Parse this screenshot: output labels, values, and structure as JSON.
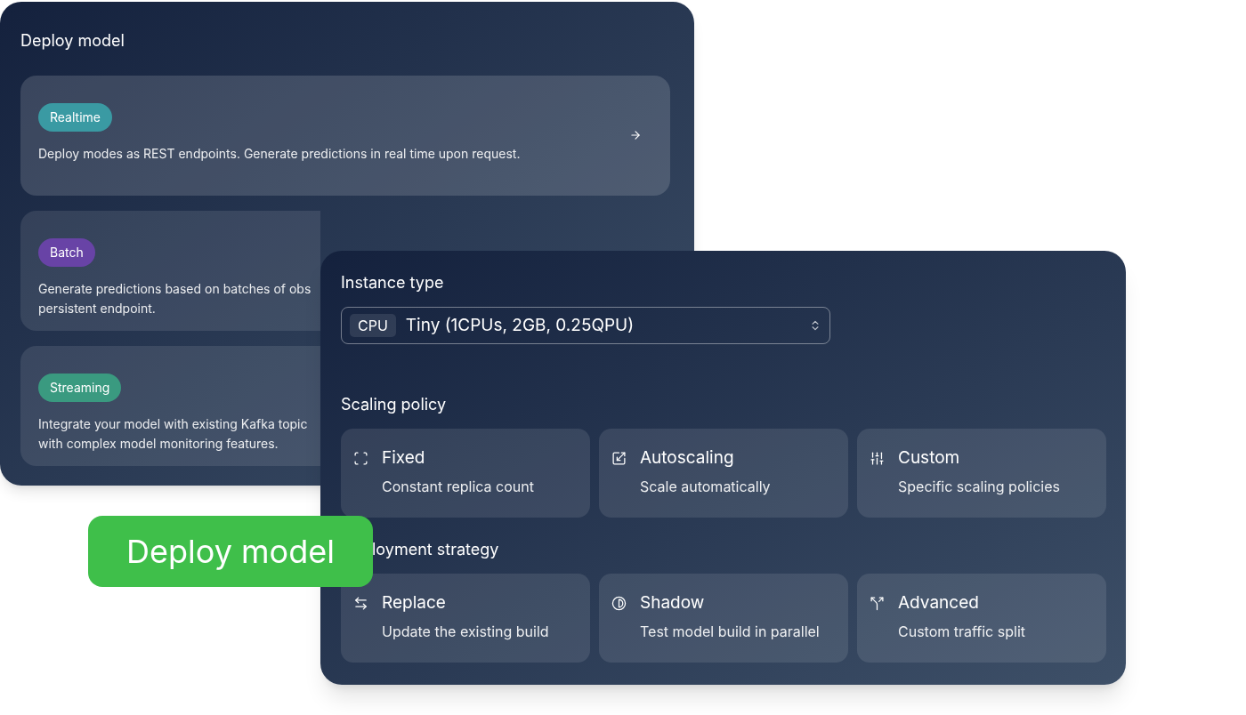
{
  "deploy_panel": {
    "title": "Deploy model",
    "options": [
      {
        "badge": "Realtime",
        "color": "#3a9aa3",
        "lines": [
          "Deploy modes as REST endpoints. Generate predictions in real time upon request."
        ],
        "selected": true
      },
      {
        "badge": "Batch",
        "color": "#6843a6",
        "lines": [
          "Generate predictions based on batches of obs",
          "persistent endpoint."
        ],
        "selected": false
      },
      {
        "badge": "Streaming",
        "color": "#3a9a80",
        "lines": [
          "Integrate your model with existing Kafka topic",
          "with complex model monitoring features."
        ],
        "selected": false
      }
    ]
  },
  "config_panel": {
    "instance_type": {
      "label": "Instance type",
      "tag": "CPU",
      "value": "Tiny (1CPUs, 2GB, 0.25QPU)"
    },
    "sections": [
      {
        "title": "Scaling policy",
        "options": [
          {
            "kind": "fixed",
            "title": "Fixed",
            "subtitle": "Constant replica count"
          },
          {
            "kind": "autoscaling",
            "title": "Autoscaling",
            "subtitle": "Scale automatically"
          },
          {
            "kind": "custom",
            "title": "Custom",
            "subtitle": "Specific scaling policies"
          }
        ]
      },
      {
        "title": "loyment strategy",
        "options": [
          {
            "kind": "replace",
            "title": "Replace",
            "subtitle": "Update the existing build"
          },
          {
            "kind": "shadow",
            "title": "Shadow",
            "subtitle": "Test model build in parallel"
          },
          {
            "kind": "advanced",
            "title": "Advanced",
            "subtitle": "Custom traffic split"
          }
        ]
      }
    ]
  },
  "deploy_button": {
    "label": "Deploy model"
  }
}
